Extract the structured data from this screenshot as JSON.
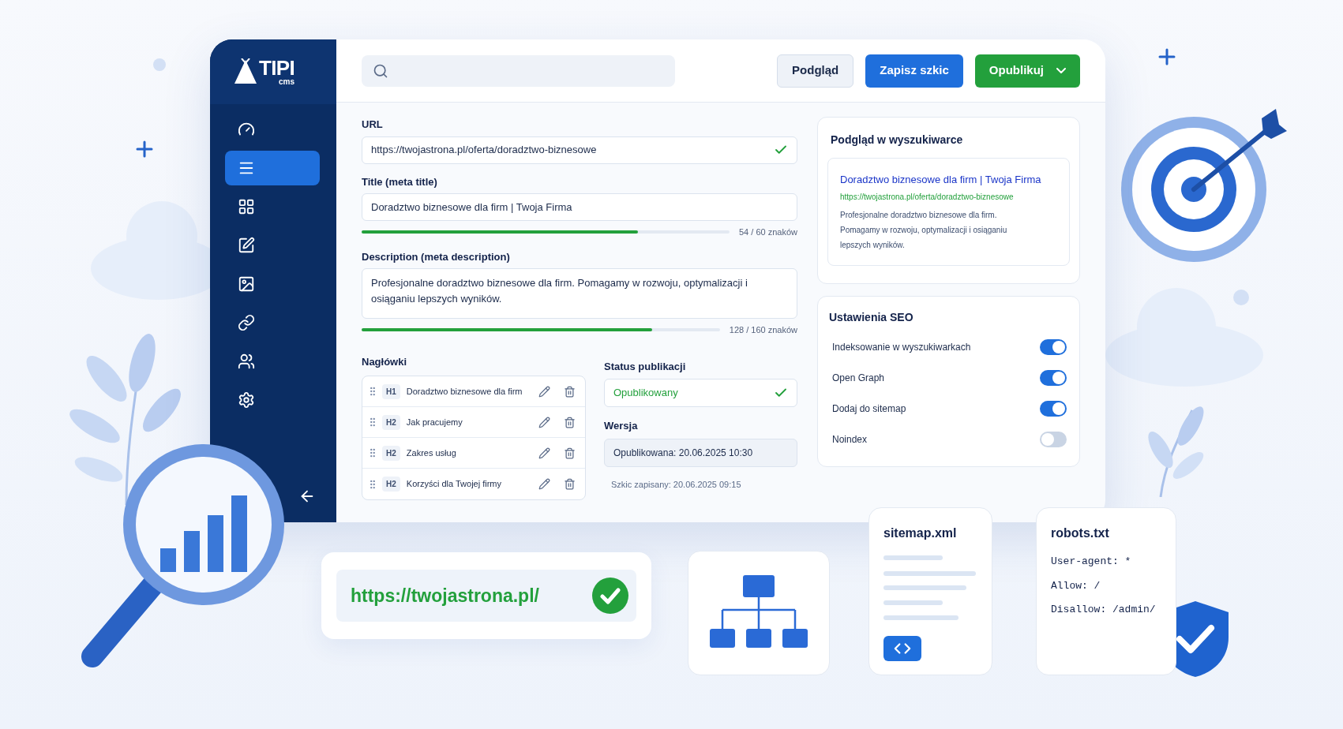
{
  "sidebar": {
    "logo": "TIPI",
    "logo_sub": "cms",
    "items": [
      {
        "selected": false
      },
      {
        "selected": true
      },
      {
        "selected": false
      },
      {
        "selected": false
      },
      {
        "selected": false
      },
      {
        "selected": false
      },
      {
        "selected": false
      },
      {
        "selected": false
      }
    ]
  },
  "toolbar": {
    "buttons": [
      {
        "label": "Podgląd",
        "kind": "secondary",
        "has_menu": false
      },
      {
        "label": "Zapisz szkic",
        "kind": "primary",
        "has_menu": false
      },
      {
        "label": "Opublikuj",
        "kind": "success",
        "has_menu": true
      }
    ]
  },
  "form": {
    "url": {
      "label": "URL",
      "value": "https://twojastrona.pl/oferta/doradztwo-biznesowe",
      "valid": true
    },
    "title": {
      "label": "Title (meta title)",
      "value": "Doradztwo biznesowe dla firm | Twoja Firma",
      "level": 0.75,
      "counter": "54 / 60 znaków"
    },
    "description": {
      "label": "Description (meta description)",
      "value": "Profesjonalne doradztwo biznesowe dla firm. Pomagamy w rozwoju, optymalizacji i osiąganiu lepszych wyników.",
      "level": 0.81,
      "counter": "128 / 160 znaków"
    },
    "headings": {
      "label": "Nagłówki",
      "items": [
        {
          "tag": "H1",
          "text": "Doradztwo biznesowe dla firm"
        },
        {
          "tag": "H2",
          "text": "Jak pracujemy"
        },
        {
          "tag": "H2",
          "text": "Zakres usług"
        },
        {
          "tag": "H2",
          "text": "Korzyści dla Twojej firmy"
        }
      ]
    },
    "status": {
      "label": "Status publikacji",
      "value": "Opublikowany",
      "valid": true
    },
    "version": {
      "label": "Wersja",
      "value": "Opublikowana: 20.06.2025 10:30",
      "draft_note": "Szkic zapisany: 20.06.2025 09:15"
    }
  },
  "serp_preview": {
    "heading": "Podgląd w wyszukiwarce",
    "title": "Doradztwo biznesowe dla firm | Twoja Firma",
    "url": "https://twojastrona.pl/oferta/doradztwo-biznesowe",
    "description": "Profesjonalne doradztwo biznesowe dla firm. Pomagamy w rozwoju, optymalizacji i osiąganiu lepszych wyników."
  },
  "seo_settings": {
    "heading": "Ustawienia SEO",
    "items": [
      {
        "label": "Indeksowanie w wyszukiwarkach",
        "on": true
      },
      {
        "label": "Open Graph",
        "on": true
      },
      {
        "label": "Dodaj do sitemap",
        "on": true
      },
      {
        "label": "Noindex",
        "on": false
      }
    ]
  },
  "url_card": {
    "url": "https://twojastrona.pl/",
    "valid": true
  },
  "sitemap_card": {
    "title": "sitemap.xml"
  },
  "robots_card": {
    "title": "robots.txt",
    "lines": [
      "User-agent: *",
      "Allow: /",
      "Disallow: /admin/"
    ]
  }
}
